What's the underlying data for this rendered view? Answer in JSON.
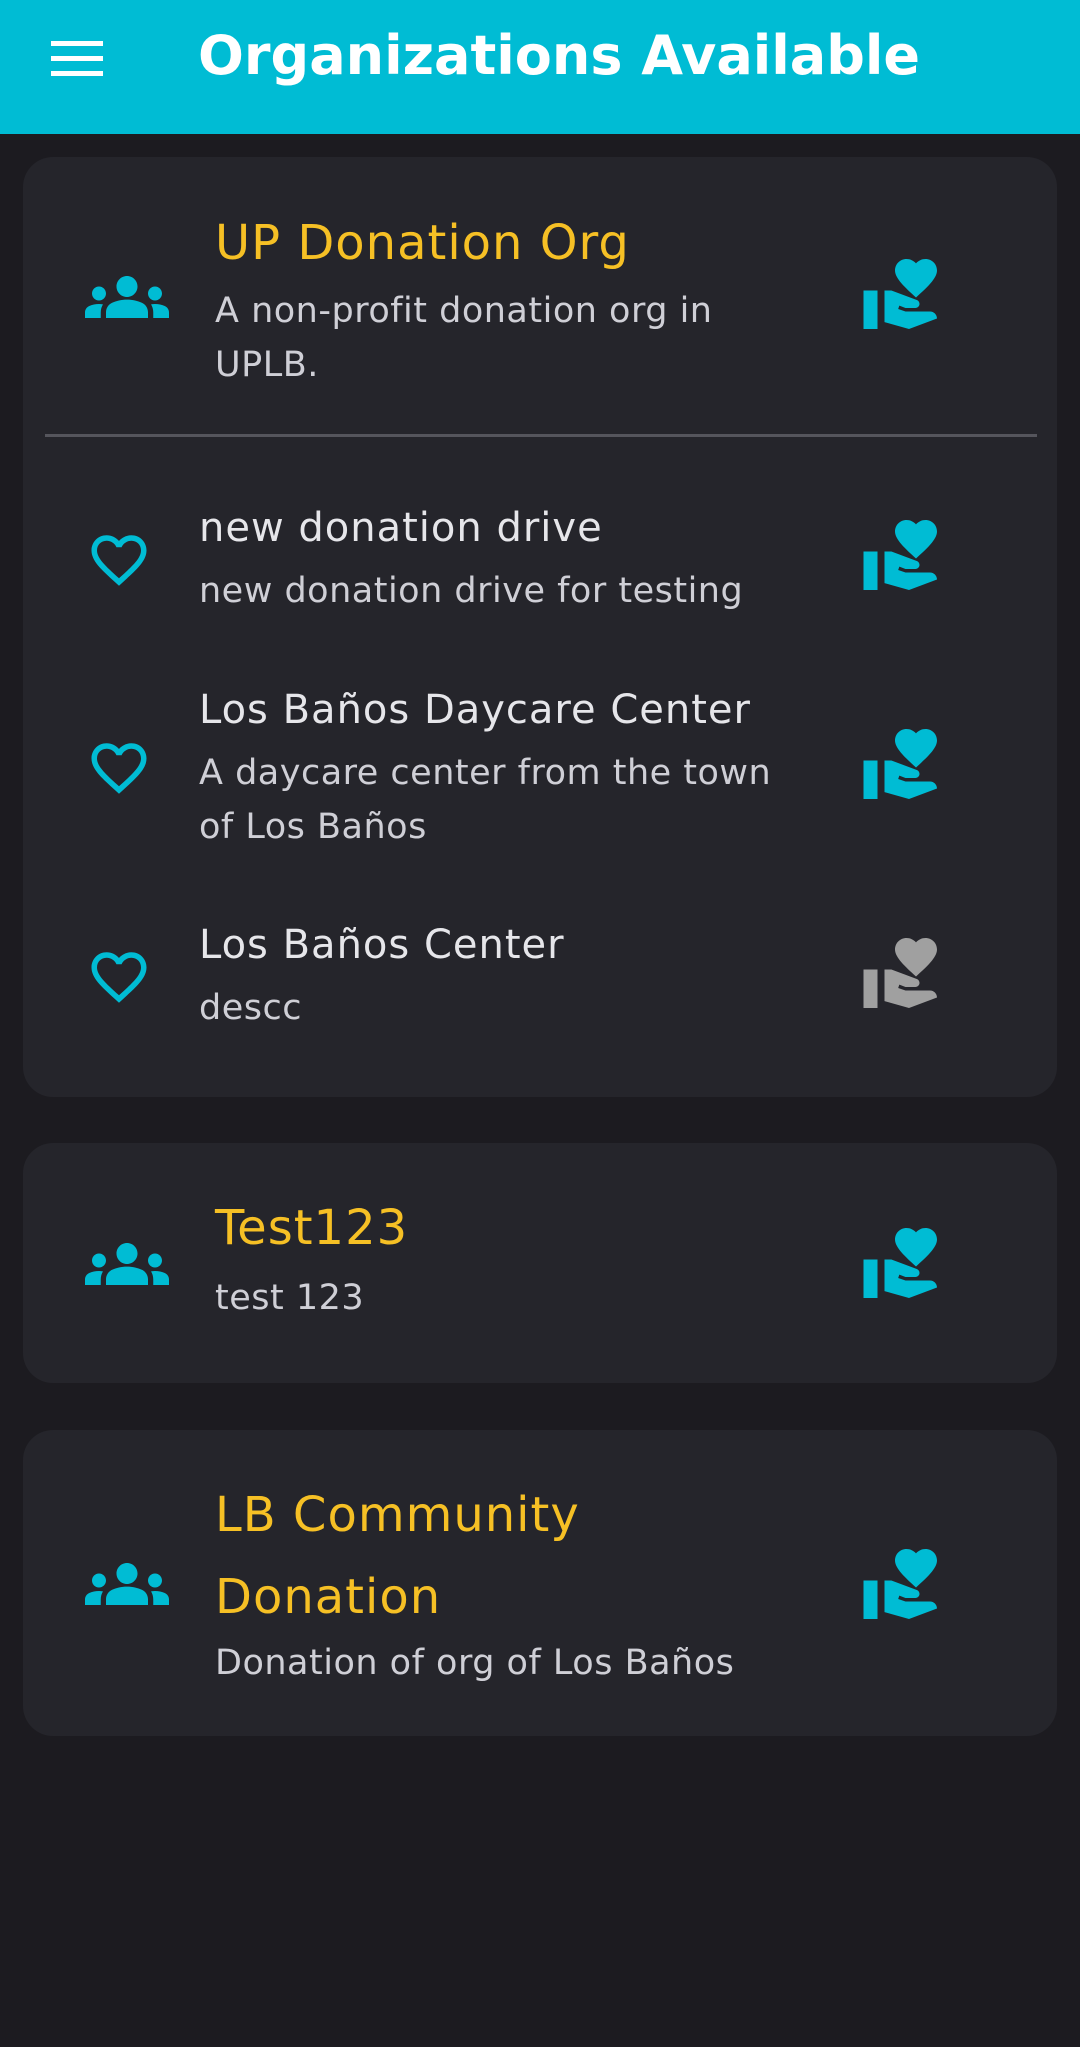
{
  "appbar": {
    "title": "Organizations Available",
    "menu_icon": "menu-icon",
    "color": "#00bcd4"
  },
  "colors": {
    "accent": "#00bcd4",
    "org_title": "#f6c025",
    "disabled_icon": "#a0a0a0",
    "card": "#25252b",
    "background": "#1c1b20"
  },
  "organizations": [
    {
      "name": "UP Donation Org",
      "description": "A non-profit donation org in UPLB.",
      "icon": "group-icon",
      "action_icon": "volunteer-hand-heart-icon",
      "drives": [
        {
          "name": "new donation drive",
          "description": "new donation drive for testing",
          "icon": "heart-outline-icon",
          "action_icon": "volunteer-hand-heart-icon",
          "enabled": true
        },
        {
          "name": "Los Baños Daycare Center",
          "description": "A daycare center from the town of Los Baños",
          "icon": "heart-outline-icon",
          "action_icon": "volunteer-hand-heart-icon",
          "enabled": true
        },
        {
          "name": "Los Baños Center",
          "description": "descc",
          "icon": "heart-outline-icon",
          "action_icon": "volunteer-hand-heart-icon",
          "enabled": false
        }
      ]
    },
    {
      "name": "Test123",
      "description": "test 123",
      "icon": "group-icon",
      "action_icon": "volunteer-hand-heart-icon"
    },
    {
      "name": "LB Community Donation",
      "description": "Donation of org of Los Baños",
      "icon": "group-icon",
      "action_icon": "volunteer-hand-heart-icon"
    }
  ]
}
